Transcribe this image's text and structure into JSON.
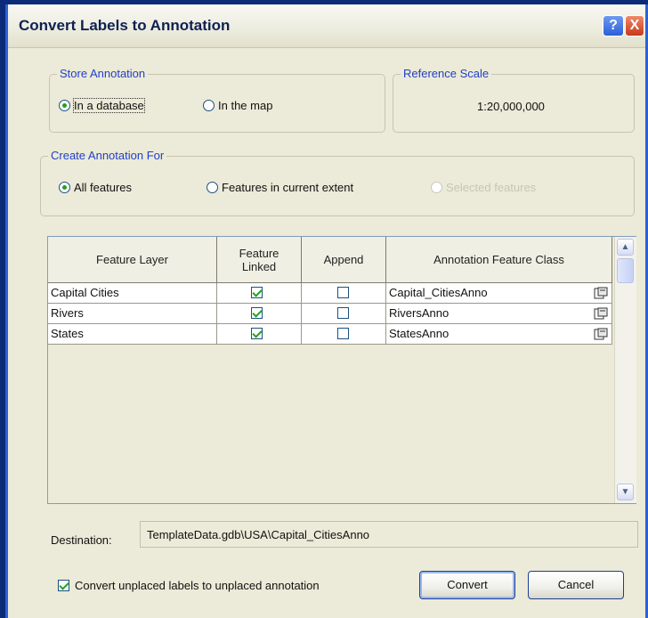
{
  "window": {
    "title": "Convert Labels to Annotation",
    "help_glyph": "?",
    "close_glyph": "X"
  },
  "store_annotation": {
    "legend": "Store Annotation",
    "options": [
      {
        "label": "In a database",
        "selected": true
      },
      {
        "label": "In the map",
        "selected": false
      }
    ]
  },
  "reference_scale": {
    "legend": "Reference Scale",
    "value": "1:20,000,000"
  },
  "create_annotation_for": {
    "legend": "Create Annotation For",
    "options": [
      {
        "label": "All features",
        "selected": true,
        "enabled": true
      },
      {
        "label": "Features in current extent",
        "selected": false,
        "enabled": true
      },
      {
        "label": "Selected features",
        "selected": false,
        "enabled": false
      }
    ]
  },
  "table": {
    "headers": [
      "Feature Layer",
      "Feature Linked",
      "Append",
      "Annotation Feature Class"
    ],
    "rows": [
      {
        "layer": "Capital Cities",
        "linked": true,
        "append": false,
        "class": "Capital_CitiesAnno"
      },
      {
        "layer": "Rivers",
        "linked": true,
        "append": false,
        "class": "RiversAnno"
      },
      {
        "layer": "States",
        "linked": true,
        "append": false,
        "class": "StatesAnno"
      }
    ],
    "scroll_up": "▲",
    "scroll_down": "▼"
  },
  "destination": {
    "label": "Destination:",
    "value": "TemplateData.gdb\\USA\\Capital_CitiesAnno"
  },
  "convert_unplaced": {
    "label": "Convert unplaced labels to unplaced annotation",
    "checked": true
  },
  "buttons": {
    "convert": "Convert",
    "cancel": "Cancel"
  },
  "colors": {
    "legend": "#2040c8",
    "check": "#21a121",
    "face": "#ecead8",
    "titlebar_border": "#2c62d6"
  },
  "icons": {
    "browse": "open-folder-icon",
    "help": "help-icon",
    "close": "close-icon"
  }
}
